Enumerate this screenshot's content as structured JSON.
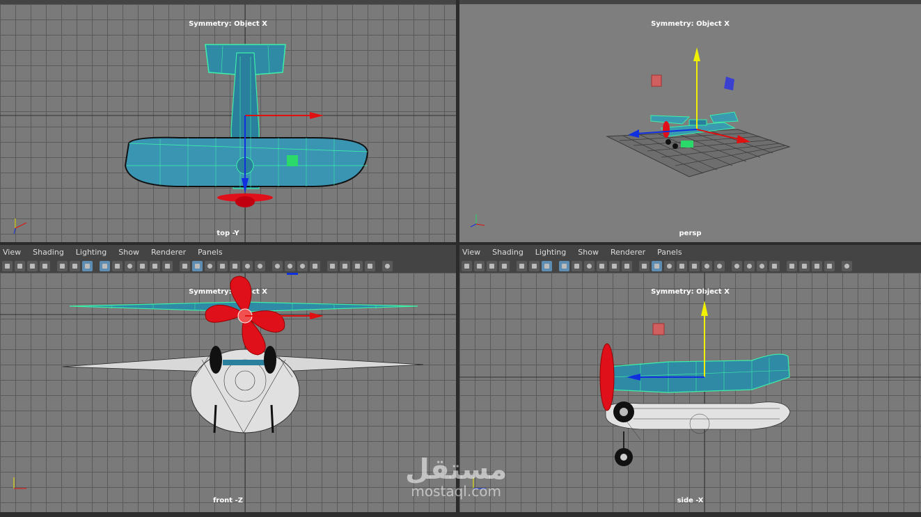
{
  "menu": [
    "View",
    "Shading",
    "Lighting",
    "Show",
    "Renderer",
    "Panels"
  ],
  "viewports": {
    "top": {
      "hud": "Symmetry: Object X",
      "camera": "top -Y"
    },
    "persp": {
      "hud": "Symmetry: Object X",
      "camera": "persp"
    },
    "front": {
      "hud": "Symmetry: Object X",
      "camera": "front -Z"
    },
    "side": {
      "hud": "Symmetry: Object X",
      "camera": "side -X"
    }
  },
  "watermark": {
    "arabic": "مستقل",
    "latin": "mostaql.com"
  },
  "colors": {
    "grid_bg": "#7a7a7a",
    "grid_line": "#5a5a5a",
    "mesh_fill": "#2f8aa6",
    "wire_highlight": "#3cf0a8",
    "propeller": "#e0101a",
    "axis_x": "#e01010",
    "axis_y": "#f0f000",
    "axis_z": "#1030e0"
  },
  "icons": [
    "camera-icon",
    "grid-icon",
    "wireframe-icon",
    "shaded-icon",
    "light-icon",
    "isolate-icon"
  ]
}
